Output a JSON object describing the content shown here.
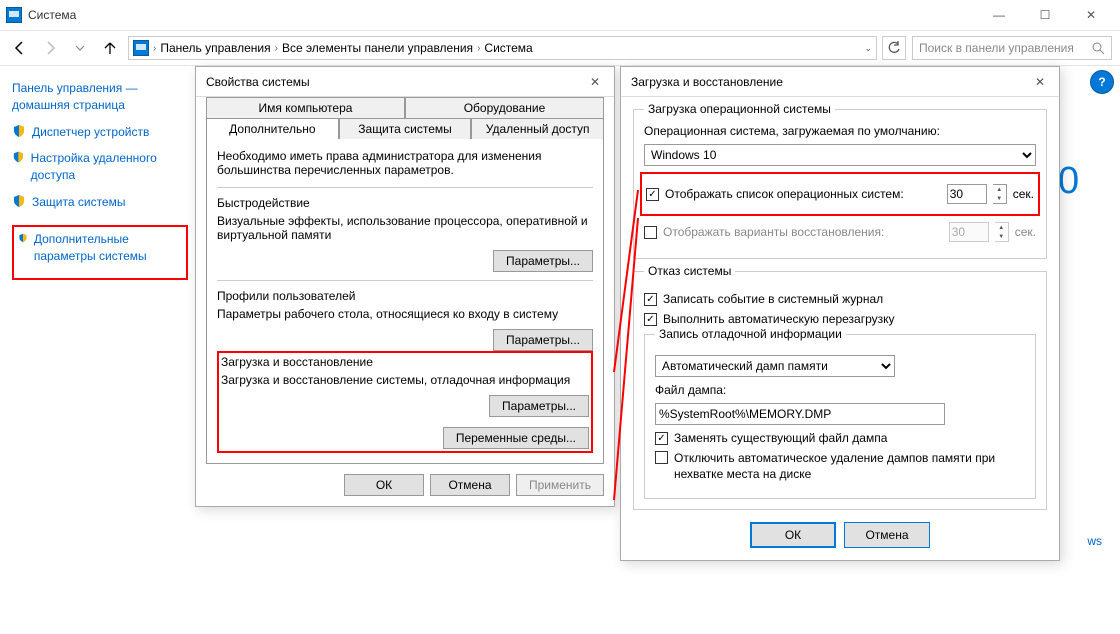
{
  "window": {
    "title": "Система"
  },
  "win_ctrls": {
    "min": "—",
    "max": "☐",
    "close": "✕"
  },
  "breadcrumb": {
    "items": [
      "Панель управления",
      "Все элементы панели управления",
      "Система"
    ],
    "search_placeholder": "Поиск в панели управления"
  },
  "leftpane": {
    "home": "Панель управления — домашняя страница",
    "links": [
      "Диспетчер устройств",
      "Настройка удаленного доступа",
      "Защита системы",
      "Дополнительные параметры системы"
    ]
  },
  "help_icon": "?",
  "sysprops": {
    "title": "Свойства системы",
    "tabs_row1": [
      "Имя компьютера",
      "Оборудование"
    ],
    "tabs_row2": [
      "Дополнительно",
      "Защита системы",
      "Удаленный доступ"
    ],
    "active_tab": 0,
    "admin_note": "Необходимо иметь права администратора для изменения большинства перечисленных параметров.",
    "perf": {
      "label": "Быстродействие",
      "desc": "Визуальные эффекты, использование процессора, оперативной и виртуальной памяти",
      "button": "Параметры..."
    },
    "profiles": {
      "label": "Профили пользователей",
      "desc": "Параметры рабочего стола, относящиеся ко входу в систему",
      "button": "Параметры..."
    },
    "startup": {
      "label": "Загрузка и восстановление",
      "desc": "Загрузка и восстановление системы, отладочная информация",
      "button": "Параметры..."
    },
    "env_button": "Переменные среды...",
    "ok": "ОК",
    "cancel": "Отмена",
    "apply": "Применить"
  },
  "startup_dlg": {
    "title": "Загрузка и восстановление",
    "boot": {
      "legend": "Загрузка операционной системы",
      "default_label": "Операционная система, загружаемая по умолчанию:",
      "default_os": "Windows 10",
      "show_list": "Отображать список операционных систем:",
      "show_list_val": "30",
      "show_recovery": "Отображать варианты восстановления:",
      "show_recovery_val": "30",
      "sec": "сек."
    },
    "fail": {
      "legend": "Отказ системы",
      "log": "Записать событие в системный журнал",
      "auto_restart": "Выполнить автоматическую перезагрузку",
      "debug_legend": "Запись отладочной информации",
      "dump_type": "Автоматический дамп памяти",
      "dump_file_label": "Файл дампа:",
      "dump_file": "%SystemRoot%\\MEMORY.DMP",
      "overwrite": "Заменять существующий файл дампа",
      "no_auto_delete": "Отключить автоматическое удаление дампов памяти при нехватке места на диске"
    },
    "ok": "ОК",
    "cancel": "Отмена"
  },
  "peek": {
    "num": "0",
    "link": "ws"
  }
}
